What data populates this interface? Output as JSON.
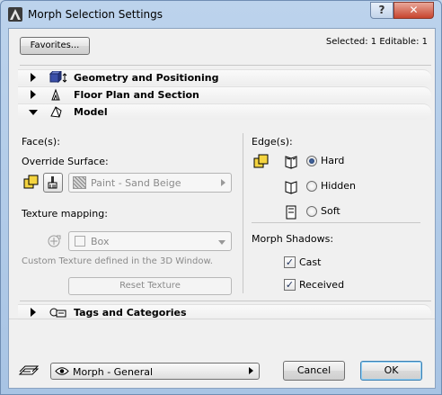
{
  "window": {
    "title": "Morph Selection Settings",
    "help_label": "?",
    "close_label": "✕"
  },
  "header": {
    "favorites_label": "Favorites...",
    "selection_info": "Selected: 1 Editable: 1"
  },
  "sections": {
    "geometry": {
      "label": "Geometry and Positioning",
      "expanded": false
    },
    "floorplan": {
      "label": "Floor Plan and Section",
      "expanded": false
    },
    "model": {
      "label": "Model",
      "expanded": true
    },
    "tags": {
      "label": "Tags and Categories",
      "expanded": false
    }
  },
  "model": {
    "faces_label": "Face(s):",
    "override_label": "Override Surface:",
    "surface_value": "Paint - Sand Beige",
    "texture_mapping_label": "Texture mapping:",
    "texture_value": "Box",
    "custom_texture_note": "Custom Texture defined in the 3D Window.",
    "reset_texture_label": "Reset Texture",
    "edges_label": "Edge(s):",
    "edge_options": [
      "Hard",
      "Hidden",
      "Soft"
    ],
    "edge_selected": "Hard",
    "shadows_label": "Morph Shadows:",
    "cast_label": "Cast",
    "cast_checked": true,
    "received_label": "Received",
    "received_checked": true
  },
  "footer": {
    "favorite_value": "Morph - General",
    "cancel_label": "Cancel",
    "ok_label": "OK"
  },
  "colors": {
    "accent": "#1c3563",
    "titlebar": "#bcd3ec",
    "close_button": "#c7442e"
  }
}
